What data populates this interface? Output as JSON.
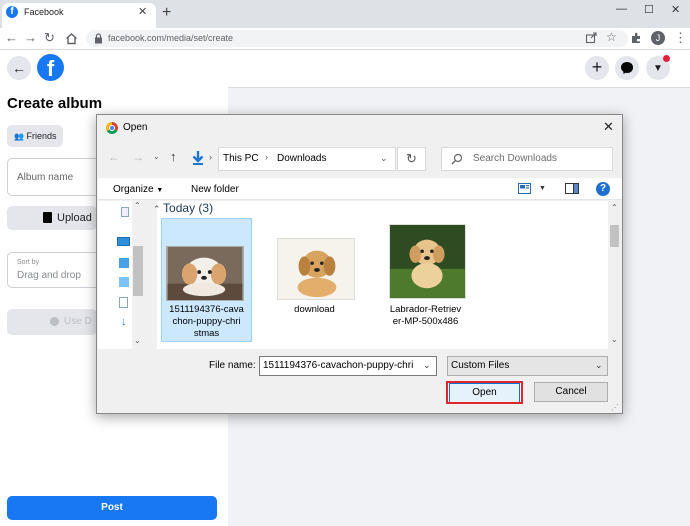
{
  "browser": {
    "tab_title": "Facebook",
    "url": "facebook.com/media/set/create",
    "profile_initial": "J"
  },
  "facebook": {
    "page_title": "Create album",
    "privacy_label": "Friends",
    "album_name_placeholder": "Album name",
    "upload_label": "Upload",
    "sort_label": "Sort by",
    "sort_value": "Drag and drop",
    "use_label": "Use D",
    "post_label": "Post"
  },
  "dialog": {
    "title": "Open",
    "breadcrumb": [
      "This PC",
      "Downloads"
    ],
    "search_placeholder": "Search Downloads",
    "organize_label": "Organize",
    "new_folder_label": "New folder",
    "group_header": "Today (3)",
    "files": [
      {
        "name": "1511194376-cavachon-puppy-christmas",
        "lines": [
          "1511194376-cava",
          "chon-puppy-chri",
          "stmas"
        ],
        "selected": true
      },
      {
        "name": "download",
        "lines": [
          "download"
        ],
        "selected": false
      },
      {
        "name": "Labrador-Retriever-MP-500x486",
        "lines": [
          "Labrador-Retriev",
          "er-MP-500x486"
        ],
        "selected": false
      }
    ],
    "file_name_label": "File name:",
    "file_name_value": "1511194376-cavachon-puppy-chri",
    "file_type_value": "Custom Files",
    "open_label": "Open",
    "cancel_label": "Cancel"
  },
  "colors": {
    "facebook_blue": "#1877f2",
    "highlight_red": "#e0262d",
    "selection_blue": "#cce8ff"
  }
}
